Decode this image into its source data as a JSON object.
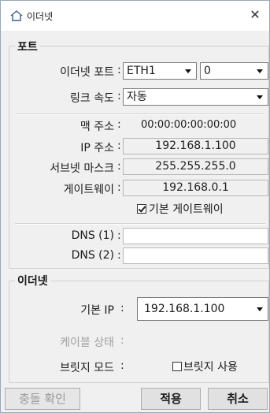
{
  "window": {
    "title": "이더넷",
    "close_glyph": "✕",
    "icon": "home-icon"
  },
  "port_group": {
    "legend": "포트",
    "ethernet_port_label": "이더넷 포트",
    "ethernet_port_value": "ETH1",
    "port_index_value": "0",
    "link_speed_label": "링크 속도",
    "link_speed_value": "자동",
    "mac_label": "맥 주소",
    "mac_value": "00:00:00:00:00:00",
    "ip_label": "IP 주소",
    "ip_value": "192.168.1.100",
    "subnet_label": "서브넷 마스크",
    "subnet_value": "255.255.255.0",
    "gateway_label": "게이트웨이",
    "gateway_value": "192.168.0.1",
    "default_gateway_checkbox_label": "기본 게이트웨이",
    "default_gateway_checked": true,
    "dns1_label": "DNS (1)",
    "dns1_value": "",
    "dns2_label": "DNS (2)",
    "dns2_value": ""
  },
  "ethernet_group": {
    "legend": "이더넷",
    "default_ip_label": "기본 IP",
    "default_ip_value": "192.168.1.100",
    "cable_status_label": "케이블 상태",
    "bridge_mode_label": "브릿지 모드",
    "bridge_use_label": "브릿지 사용",
    "bridge_use_checked": false
  },
  "buttons": {
    "collision_check": "충돌 확인",
    "apply": "적용",
    "cancel": "취소"
  },
  "colon": ":"
}
